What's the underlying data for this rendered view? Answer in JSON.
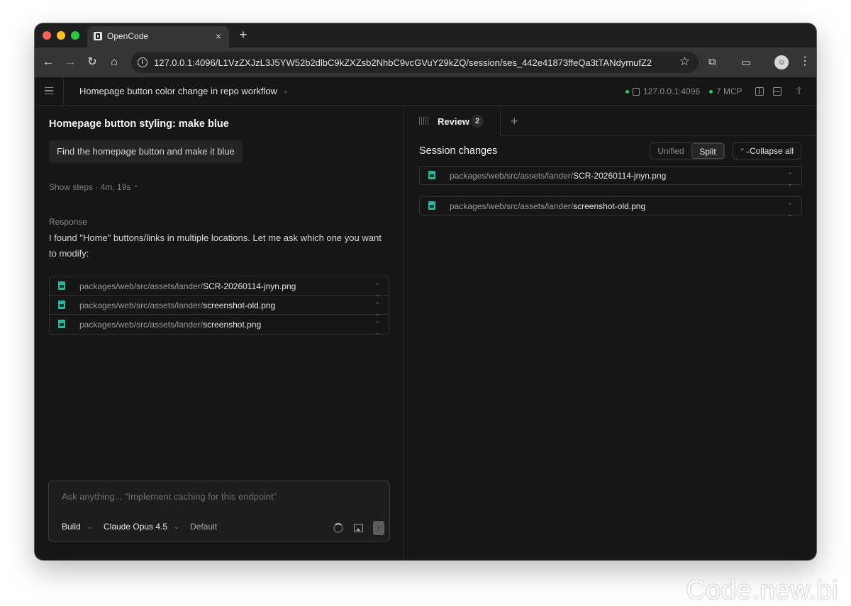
{
  "browser": {
    "tab_title": "OpenCode",
    "tab_close": "×",
    "new_tab": "+",
    "url": "127.0.0.1:4096/L1VzZXJzL3J5YW52b2dlbC9kZXZsb2NhbC9vcGVuY29kZQ/session/ses_442e41873ffeQa3tTANdymufZ2",
    "icons": [
      "back-icon",
      "forward-icon",
      "reload-icon",
      "home-icon",
      "info-icon",
      "bookmark-star-icon",
      "extensions-icon",
      "cast-icon",
      "avatar",
      "menu-dots-icon"
    ]
  },
  "header": {
    "session_title": "Homepage button color change in repo workflow",
    "server": "127.0.0.1:4096",
    "mcp": "7 MCP",
    "status_color": "#22c55e"
  },
  "left": {
    "prompt_title": "Homepage button styling: make blue",
    "user_message": "Find the homepage button and make it blue",
    "show_steps": "Show steps · 4m, 19s",
    "response_label": "Response",
    "response_text": "I found \"Home\" buttons/links in multiple locations. Let me ask which one you want to modify:",
    "files": [
      {
        "dir": "packages/web/src/assets/lander/",
        "name": "SCR-20260114-jnyn.png"
      },
      {
        "dir": "packages/web/src/assets/lander/",
        "name": "screenshot-old.png"
      },
      {
        "dir": "packages/web/src/assets/lander/",
        "name": "screenshot.png"
      }
    ],
    "composer": {
      "placeholder": "Ask anything... \"Implement caching for this endpoint\"",
      "agent": "Build",
      "model": "Claude Opus 4.5",
      "variant": "Default"
    }
  },
  "right": {
    "tab_label": "Review",
    "tab_count": "2",
    "add_tab": "+",
    "section_title": "Session changes",
    "view_options": [
      "Unified",
      "Split"
    ],
    "active_view": "Split",
    "collapse_all": "Collapse all",
    "files": [
      {
        "dir": "packages/web/src/assets/lander/",
        "name": "SCR-20260114-jnyn.png"
      },
      {
        "dir": "packages/web/src/assets/lander/",
        "name": "screenshot-old.png"
      }
    ]
  },
  "colors": {
    "accent_file_icon": "#2fb39a",
    "background": "#161616"
  },
  "watermark": "Code.new.bi"
}
